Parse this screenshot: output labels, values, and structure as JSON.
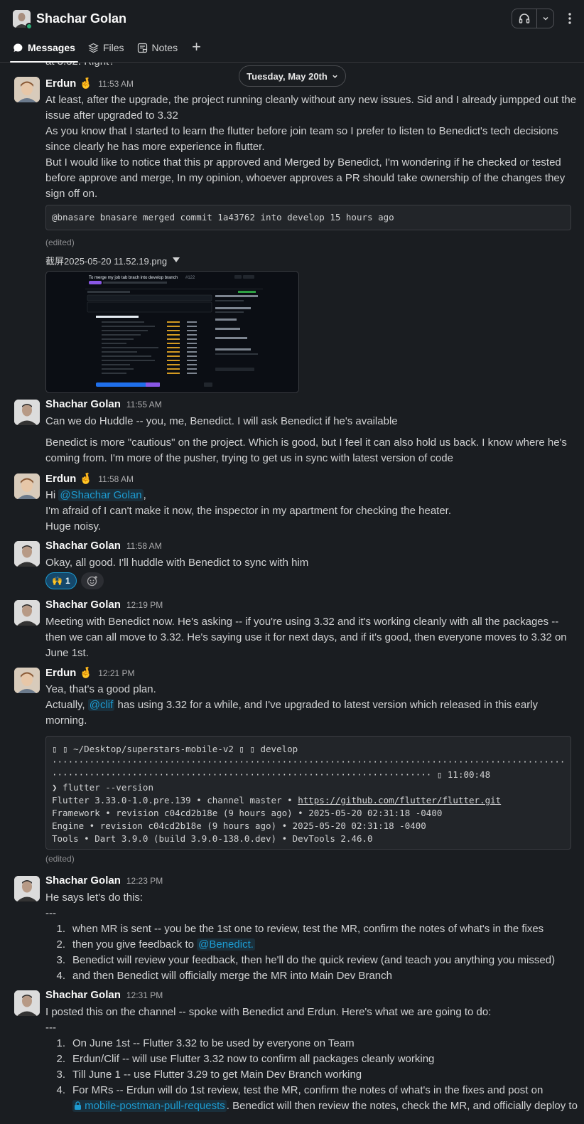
{
  "header": {
    "name": "Shachar Golan",
    "tabs": [
      {
        "label": "Messages"
      },
      {
        "label": "Files"
      },
      {
        "label": "Notes"
      }
    ]
  },
  "date_divider": "Tuesday, May 20th",
  "cutoff_text": "at 3.32. Right?",
  "messages": [
    {
      "author": "Erdun 🤞",
      "time": "11:53 AM",
      "lines": [
        "At least, after the upgrade, the project running cleanly without any new issues. Sid and I already jumpped out the",
        "issue after upgraded to 3.32",
        "As you know that I started to learn the flutter before join team so I prefer to listen to Benedict's tech decisions",
        "since clearly he has more experience in flutter.",
        "But I would like to notice that this pr approved and Merged by Benedict, I'm wondering if he checked or tested",
        "before approve and merge, In my opinion, whoever approves a PR should take ownership of the changes they",
        "sign off on."
      ],
      "code": "@bnasare bnasare merged commit 1a43762 into develop 15 hours ago",
      "edited": "(edited)",
      "file_name": "截屏2025-05-20 11.52.19.png",
      "screenshot_title": "To merge my job tab brach into develop branch",
      "screenshot_pr": "#122"
    },
    {
      "author": "Shachar Golan",
      "time": "11:55 AM",
      "lines": [
        "Can we do Huddle -- you, me, Benedict. I will ask Benedict if he's available"
      ],
      "lines2": [
        "Benedict is more \"cautious\" on the project. Which is good, but I feel it can also hold us back. I know where he's",
        "coming from. I'm more of the pusher, trying to get us in sync with latest version of code"
      ]
    },
    {
      "author": "Erdun 🤞",
      "time": "11:58 AM",
      "hi": "Hi",
      "mention": "@Shachar Golan",
      "after_mention": ",",
      "lines": [
        "I'm afraid of I can't make it now, the inspector in my apartment for checking the heater.",
        "Huge noisy."
      ]
    },
    {
      "author": "Shachar Golan",
      "time": "11:58 AM",
      "lines": [
        "Okay, all good. I'll huddle with Benedict to sync with him"
      ],
      "reaction": {
        "emoji": "🙌",
        "count": "1"
      }
    },
    {
      "author": "Shachar Golan",
      "time": "12:19 PM",
      "lines": [
        "Meeting with Benedict now. He's asking -- if you're using 3.32 and it's working cleanly with all the packages --",
        "then we can all move to 3.32. He's saying use it for next days, and if it's good, then everyone moves to 3.32 on",
        "June 1st."
      ]
    },
    {
      "author": "Erdun 🤞",
      "time": "12:21 PM",
      "line1": "Yea, that's a good plan.",
      "pre_mention": "Actually,",
      "mention": "@clif",
      "post_mention": "has using 3.32 for a while, and I've upgraded to latest version which released in this early",
      "line3": "morning.",
      "code_lines": [
        "▯ ▯ ~/Desktop/superstars-mobile-v2 ▯ ▯ develop",
        "··································································································",
        "······································································· ▯ 11:00:48",
        "❯ flutter --version",
        "Flutter 3.33.0-1.0.pre.139 • channel master • ",
        "Framework • revision c04cd2b18e (9 hours ago) • 2025-05-20 02:31:18 -0400",
        "Engine • revision c04cd2b18e (9 hours ago) • 2025-05-20 02:31:18 -0400",
        "Tools • Dart 3.9.0 (build 3.9.0-138.0.dev) • DevTools 2.46.0"
      ],
      "code_link": "https://github.com/flutter/flutter.git",
      "edited": "(edited)"
    },
    {
      "author": "Shachar Golan",
      "time": "12:23 PM",
      "line1": "He says let's do this:",
      "dashes": "---",
      "items": [
        {
          "n": "1.",
          "t": "when MR is sent -- you be the 1st one to review, test the MR, confirm the notes of what's in the fixes"
        },
        {
          "n": "2.",
          "t": "then you give feedback to",
          "mention": "@Benedict."
        },
        {
          "n": "3.",
          "t": "Benedict will review your feedback, then he'll do the quick review (and teach you anything you missed)"
        },
        {
          "n": "4.",
          "t": "and then Benedict will officially merge the MR into Main Dev Branch"
        }
      ]
    },
    {
      "author": "Shachar Golan",
      "time": "12:31 PM",
      "line1": "I posted this on the channel -- spoke with Benedict and Erdun. Here's what we are going to do:",
      "dashes": "---",
      "items": [
        {
          "n": "1.",
          "t": "On June 1st -- Flutter 3.32 to be used by everyone on Team"
        },
        {
          "n": "2.",
          "t": "Erdun/Clif -- will use Flutter 3.32 now to confirm all packages cleanly working"
        },
        {
          "n": "3.",
          "t": "Till June 1 -- use Flutter 3.29 to get Main Dev Branch working"
        },
        {
          "n": "4.",
          "t": "For MRs -- Erdun will do 1st review, test the MR, confirm the notes of what's in the fixes and post on"
        }
      ],
      "channel": "mobile-postman-pull-requests",
      "item4_cont": ". Benedict will then review the notes, check the MR, and officially deploy to"
    }
  ]
}
